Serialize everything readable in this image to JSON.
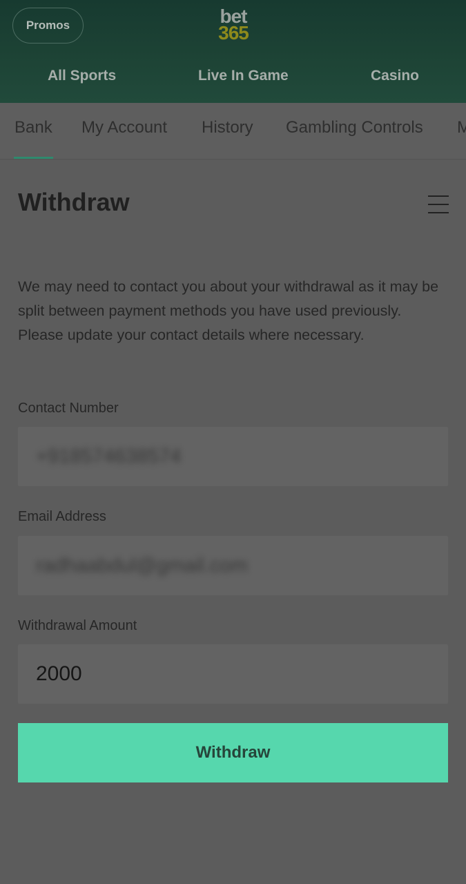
{
  "header": {
    "promos_label": "Promos",
    "logo_line1": "bet",
    "logo_line2": "365",
    "nav": [
      "All Sports",
      "Live In Game",
      "Casino"
    ]
  },
  "tabs": {
    "items": [
      "Bank",
      "My Account",
      "History",
      "Gambling Controls",
      "M"
    ],
    "active": "Bank"
  },
  "page": {
    "title": "Withdraw",
    "info_text": "We may need to contact you about your withdrawal as it may be split between payment methods you have used previously. Please update your contact details where necessary."
  },
  "form": {
    "contact_label": "Contact Number",
    "contact_value": "+918574638574",
    "email_label": "Email Address",
    "email_value": "radhaabdul@gmail.com",
    "amount_label": "Withdrawal Amount",
    "amount_value": "2000",
    "submit_label": "Withdraw"
  },
  "colors": {
    "header_bg": "#1d4335",
    "overlay_bg": "#5c5c5c",
    "button_accent": "#56d7ad",
    "tab_indicator": "#2f8a6e"
  }
}
